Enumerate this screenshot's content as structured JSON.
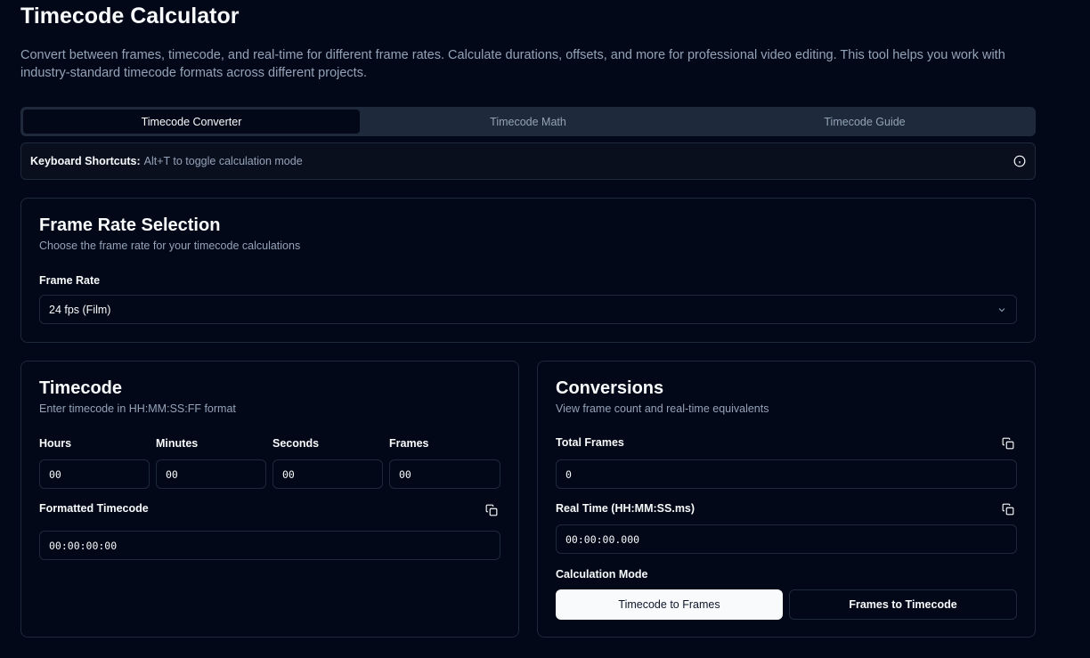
{
  "header": {
    "title": "Timecode Calculator",
    "description": "Convert between frames, timecode, and real-time for different frame rates. Calculate durations, offsets, and more for professional video editing. This tool helps you work with industry-standard timecode formats across different projects."
  },
  "tabs": [
    {
      "label": "Timecode Converter",
      "active": true
    },
    {
      "label": "Timecode Math",
      "active": false
    },
    {
      "label": "Timecode Guide",
      "active": false
    }
  ],
  "shortcuts": {
    "label": "Keyboard Shortcuts:",
    "text": "Alt+T to toggle calculation mode",
    "icon": "info-icon"
  },
  "frame_rate": {
    "title": "Frame Rate Selection",
    "subtitle": "Choose the frame rate for your timecode calculations",
    "field_label": "Frame Rate",
    "selected": "24 fps (Film)"
  },
  "timecode": {
    "title": "Timecode",
    "subtitle": "Enter timecode in HH:MM:SS:FF format",
    "hours_label": "Hours",
    "minutes_label": "Minutes",
    "seconds_label": "Seconds",
    "frames_label": "Frames",
    "hours": "00",
    "minutes": "00",
    "seconds": "00",
    "frames": "00",
    "formatted_label": "Formatted Timecode",
    "formatted_value": "00:00:00:00"
  },
  "conversions": {
    "title": "Conversions",
    "subtitle": "View frame count and real-time equivalents",
    "total_frames_label": "Total Frames",
    "total_frames_value": "0",
    "real_time_label": "Real Time (HH:MM:SS.ms)",
    "real_time_value": "00:00:00.000",
    "mode_label": "Calculation Mode",
    "mode_tc_to_frames": "Timecode to Frames",
    "mode_frames_to_tc": "Frames to Timecode",
    "active_mode": "Timecode to Frames"
  },
  "colors": {
    "background": "#020817",
    "border": "#1e293b",
    "muted_text": "#94a3b8",
    "text": "#f8fafc"
  }
}
